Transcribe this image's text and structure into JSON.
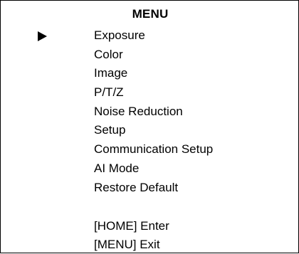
{
  "menu": {
    "title": "MENU",
    "selected_index": 0,
    "items": [
      {
        "label": "Exposure"
      },
      {
        "label": "Color"
      },
      {
        "label": "Image"
      },
      {
        "label": "P/T/Z"
      },
      {
        "label": "Noise Reduction"
      },
      {
        "label": "Setup"
      },
      {
        "label": "Communication Setup"
      },
      {
        "label": "AI Mode"
      },
      {
        "label": "Restore Default"
      }
    ]
  },
  "hints": {
    "enter": "[HOME] Enter",
    "exit": "[MENU] Exit"
  }
}
